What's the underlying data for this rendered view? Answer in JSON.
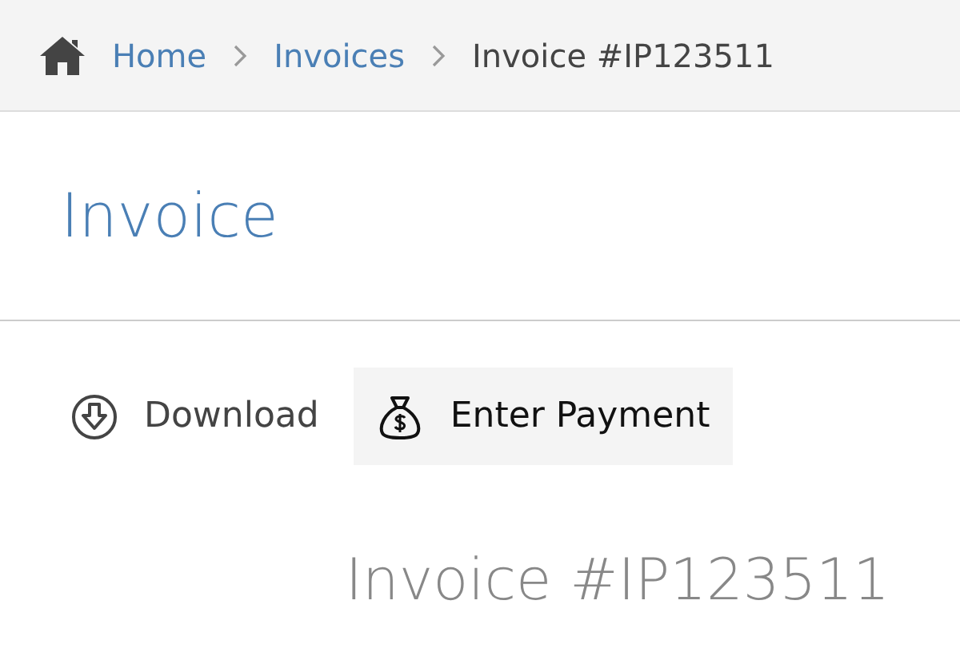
{
  "breadcrumb": [
    {
      "label": "Home",
      "kind": "link"
    },
    {
      "label": "Invoices",
      "kind": "link"
    },
    {
      "label": "Invoice #IP123511",
      "kind": "current"
    }
  ],
  "page_title": "Invoice",
  "actions": [
    {
      "label": "Download",
      "kind": "download",
      "selected": false
    },
    {
      "label": "Enter Payment",
      "kind": "payment",
      "selected": true
    }
  ],
  "document_heading": "Invoice #IP123511"
}
